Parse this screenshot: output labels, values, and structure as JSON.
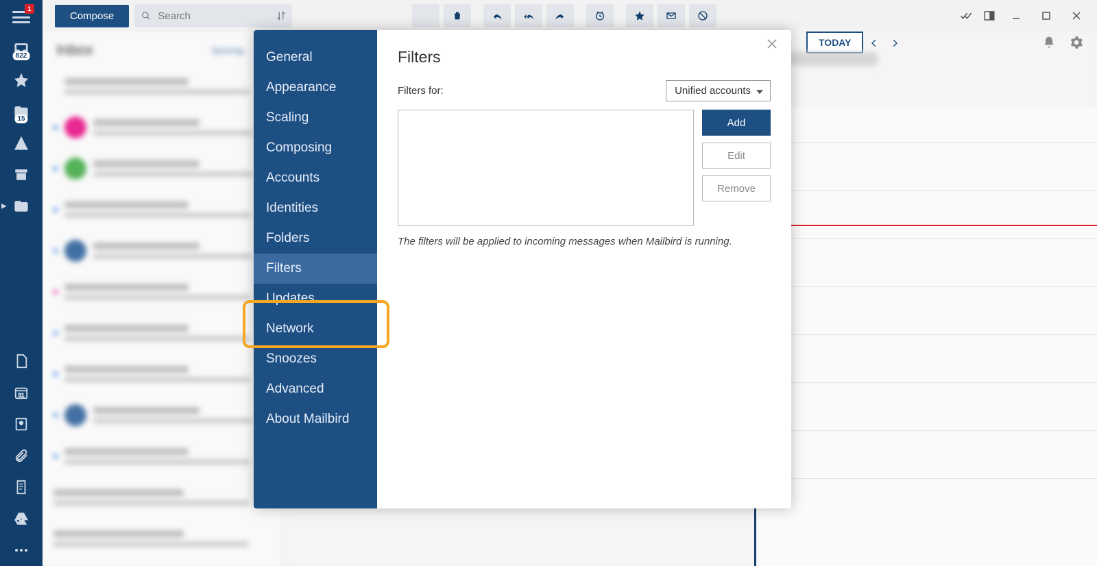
{
  "rail": {
    "menu_badge": "1",
    "inbox_count": "822",
    "folder_count": "15"
  },
  "toolbar": {
    "compose": "Compose",
    "search_placeholder": "Search"
  },
  "inbox": {
    "title": "Inbox",
    "sync": "Syncing..."
  },
  "calendar": {
    "today": "TODAY"
  },
  "settings": {
    "nav": {
      "general": "General",
      "appearance": "Appearance",
      "scaling": "Scaling",
      "composing": "Composing",
      "accounts": "Accounts",
      "identities": "Identities",
      "folders": "Folders",
      "filters": "Filters",
      "updates": "Updates",
      "network": "Network",
      "snoozes": "Snoozes",
      "advanced": "Advanced",
      "about": "About Mailbird"
    },
    "panel": {
      "title": "Filters",
      "for_label": "Filters for:",
      "account": "Unified accounts",
      "add": "Add",
      "edit": "Edit",
      "remove": "Remove",
      "hint": "The filters will be applied to incoming messages when Mailbird is running."
    }
  }
}
